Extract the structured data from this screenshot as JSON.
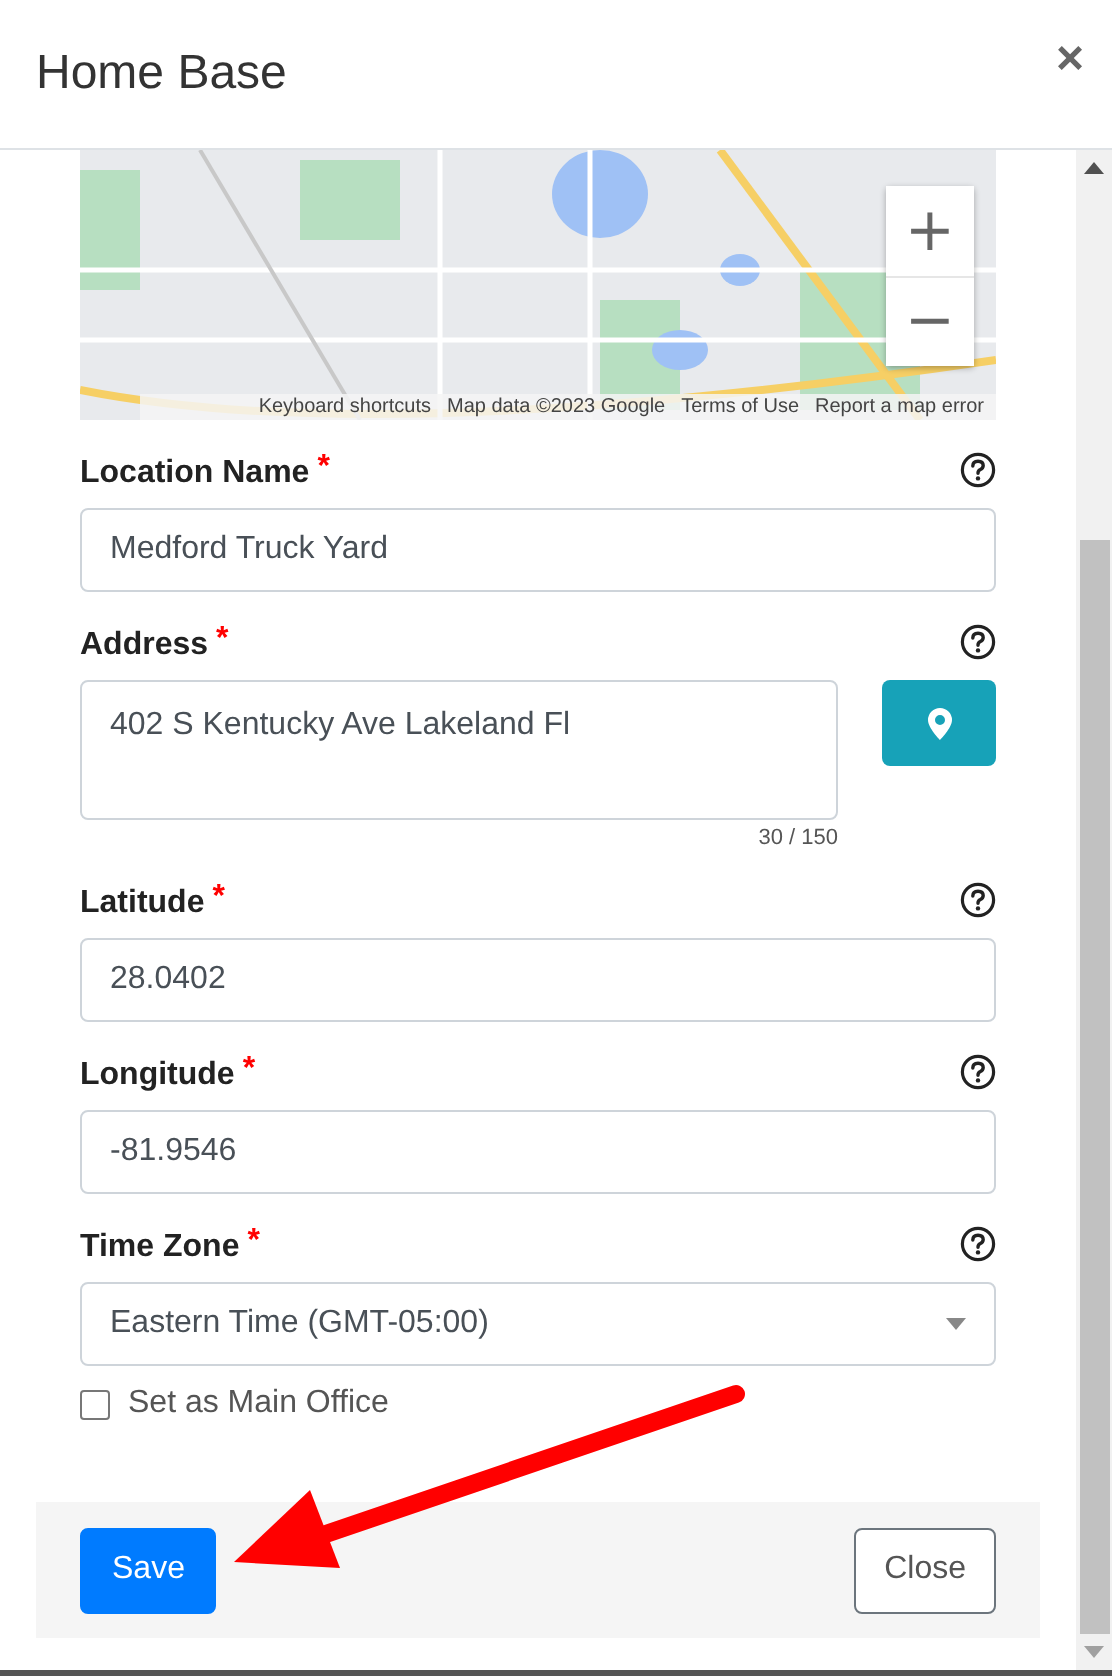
{
  "dialog": {
    "title": "Home Base",
    "close_label": "×"
  },
  "map": {
    "zoom_in": "+",
    "zoom_out": "−",
    "attribution": [
      "Keyboard shortcuts",
      "Map data ©2023 Google",
      "Terms of Use",
      "Report a map error"
    ]
  },
  "fields": [
    {
      "kind": "text",
      "label": "Location Name",
      "required_mark": "*",
      "value": "Medford Truck Yard"
    },
    {
      "kind": "textarea",
      "label": "Address",
      "required_mark": "*",
      "value": "402 S Kentucky Ave Lakeland Fl",
      "counter": "30 / 150"
    },
    {
      "kind": "text",
      "label": "Latitude",
      "required_mark": "*",
      "value": "28.0402"
    },
    {
      "kind": "text",
      "label": "Longitude",
      "required_mark": "*",
      "value": "-81.9546"
    },
    {
      "kind": "select",
      "label": "Time Zone",
      "required_mark": "*",
      "value": "Eastern Time (GMT-05:00)"
    }
  ],
  "checkbox": {
    "label": "Set as Main Office",
    "checked": false
  },
  "buttons": [
    {
      "label": "Save",
      "kind": "primary"
    },
    {
      "label": "Close",
      "kind": "secondary"
    }
  ]
}
